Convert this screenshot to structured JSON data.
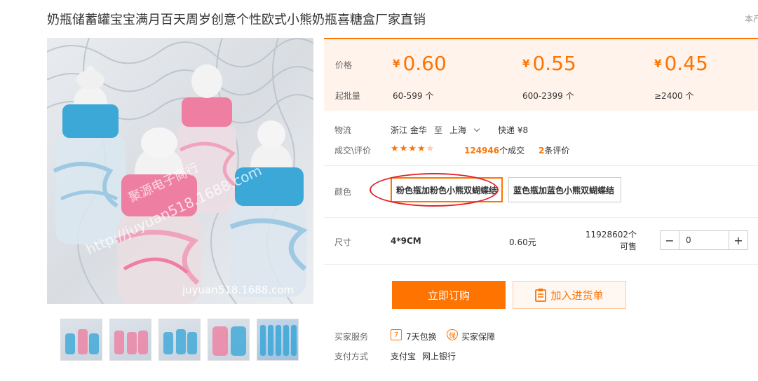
{
  "title": "奶瓶储蓄罐宝宝满月百天周岁创意个性欧式小熊奶瓶喜糖盒厂家直销",
  "corner_tag": "本产",
  "watermark": {
    "url": "http://juyuan518.1688.com",
    "shop": "聚源电子商行",
    "bottom": "juyuan518.1688.com"
  },
  "price_box": {
    "price_label": "价格",
    "moq_label": "起批量",
    "currency": "¥",
    "tiers": [
      {
        "price": "0.60",
        "moq": "60-599 个"
      },
      {
        "price": "0.55",
        "moq": "600-2399 个"
      },
      {
        "price": "0.45",
        "moq": "≥2400 个"
      }
    ]
  },
  "logistics": {
    "label": "物流",
    "from": "浙江 金华",
    "to_word": "至",
    "to": "上海",
    "express": "快递 ¥8"
  },
  "trade": {
    "label": "成交\\评价",
    "rating": 4.5,
    "deals_num": "124946",
    "deals_text": "个成交",
    "reviews_num": "2",
    "reviews_text": "条评价"
  },
  "color": {
    "label": "颜色",
    "options": [
      {
        "label": "粉色瓶加粉色小熊双蝴蝶结",
        "selected": true
      },
      {
        "label": "蓝色瓶加蓝色小熊双蝴蝶结",
        "selected": false
      }
    ]
  },
  "size": {
    "label": "尺寸",
    "value": "4*9CM",
    "price": "0.60元",
    "stock": "11928602个可售",
    "quantity": "0"
  },
  "actions": {
    "buy": "立即订购",
    "cart": "加入进货单"
  },
  "services": {
    "label": "买家服务",
    "items": [
      {
        "icon": "7",
        "text": "7天包换"
      },
      {
        "icon": "保",
        "text": "买家保障"
      }
    ]
  },
  "payment": {
    "label": "支付方式",
    "methods": [
      "支付宝",
      "网上银行"
    ]
  },
  "colors": {
    "accent": "#ff7300",
    "price_bg": "#fff3eb",
    "annotation_red": "#e0232b",
    "bottle_blue": "#3ba8d8",
    "bottle_pink": "#ee7fa3"
  }
}
